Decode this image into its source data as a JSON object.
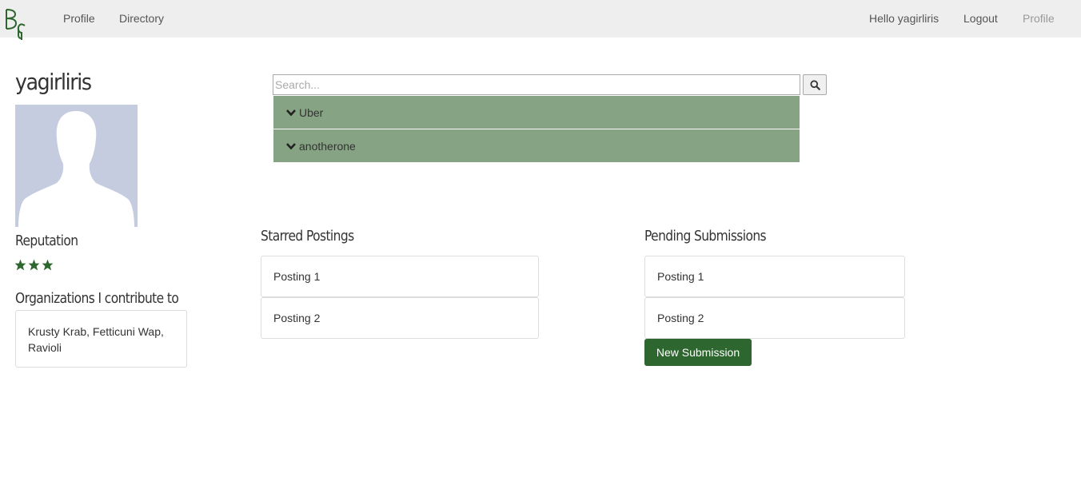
{
  "navbar": {
    "left_links": [
      "Profile",
      "Directory"
    ],
    "greeting": "Hello yagirliris",
    "logout": "Logout",
    "profile": "Profile",
    "logo_icon": "bc-logo-icon"
  },
  "profile": {
    "username": "yagirliris",
    "avatar_icon": "default-avatar-silhouette",
    "reputation_heading": "Reputation",
    "reputation_stars": 3,
    "organizations_heading": "Organizations I contribute to",
    "organizations_text": "Krusty Krab, Fetticuni Wap, Ravioli"
  },
  "search": {
    "placeholder": "Search...",
    "button_icon": "search-icon",
    "results": [
      {
        "label": "Uber"
      },
      {
        "label": "anotherone"
      }
    ]
  },
  "starred": {
    "heading": "Starred Postings",
    "items": [
      "Posting 1",
      "Posting 2"
    ]
  },
  "pending": {
    "heading": "Pending Submissions",
    "items": [
      "Posting 1",
      "Posting 2"
    ],
    "new_button": "New Submission"
  },
  "colors": {
    "navbar_bg": "#eeeeee",
    "result_bg": "#86a384",
    "accent_green": "#2e6630",
    "avatar_bg": "#c5cce0"
  }
}
